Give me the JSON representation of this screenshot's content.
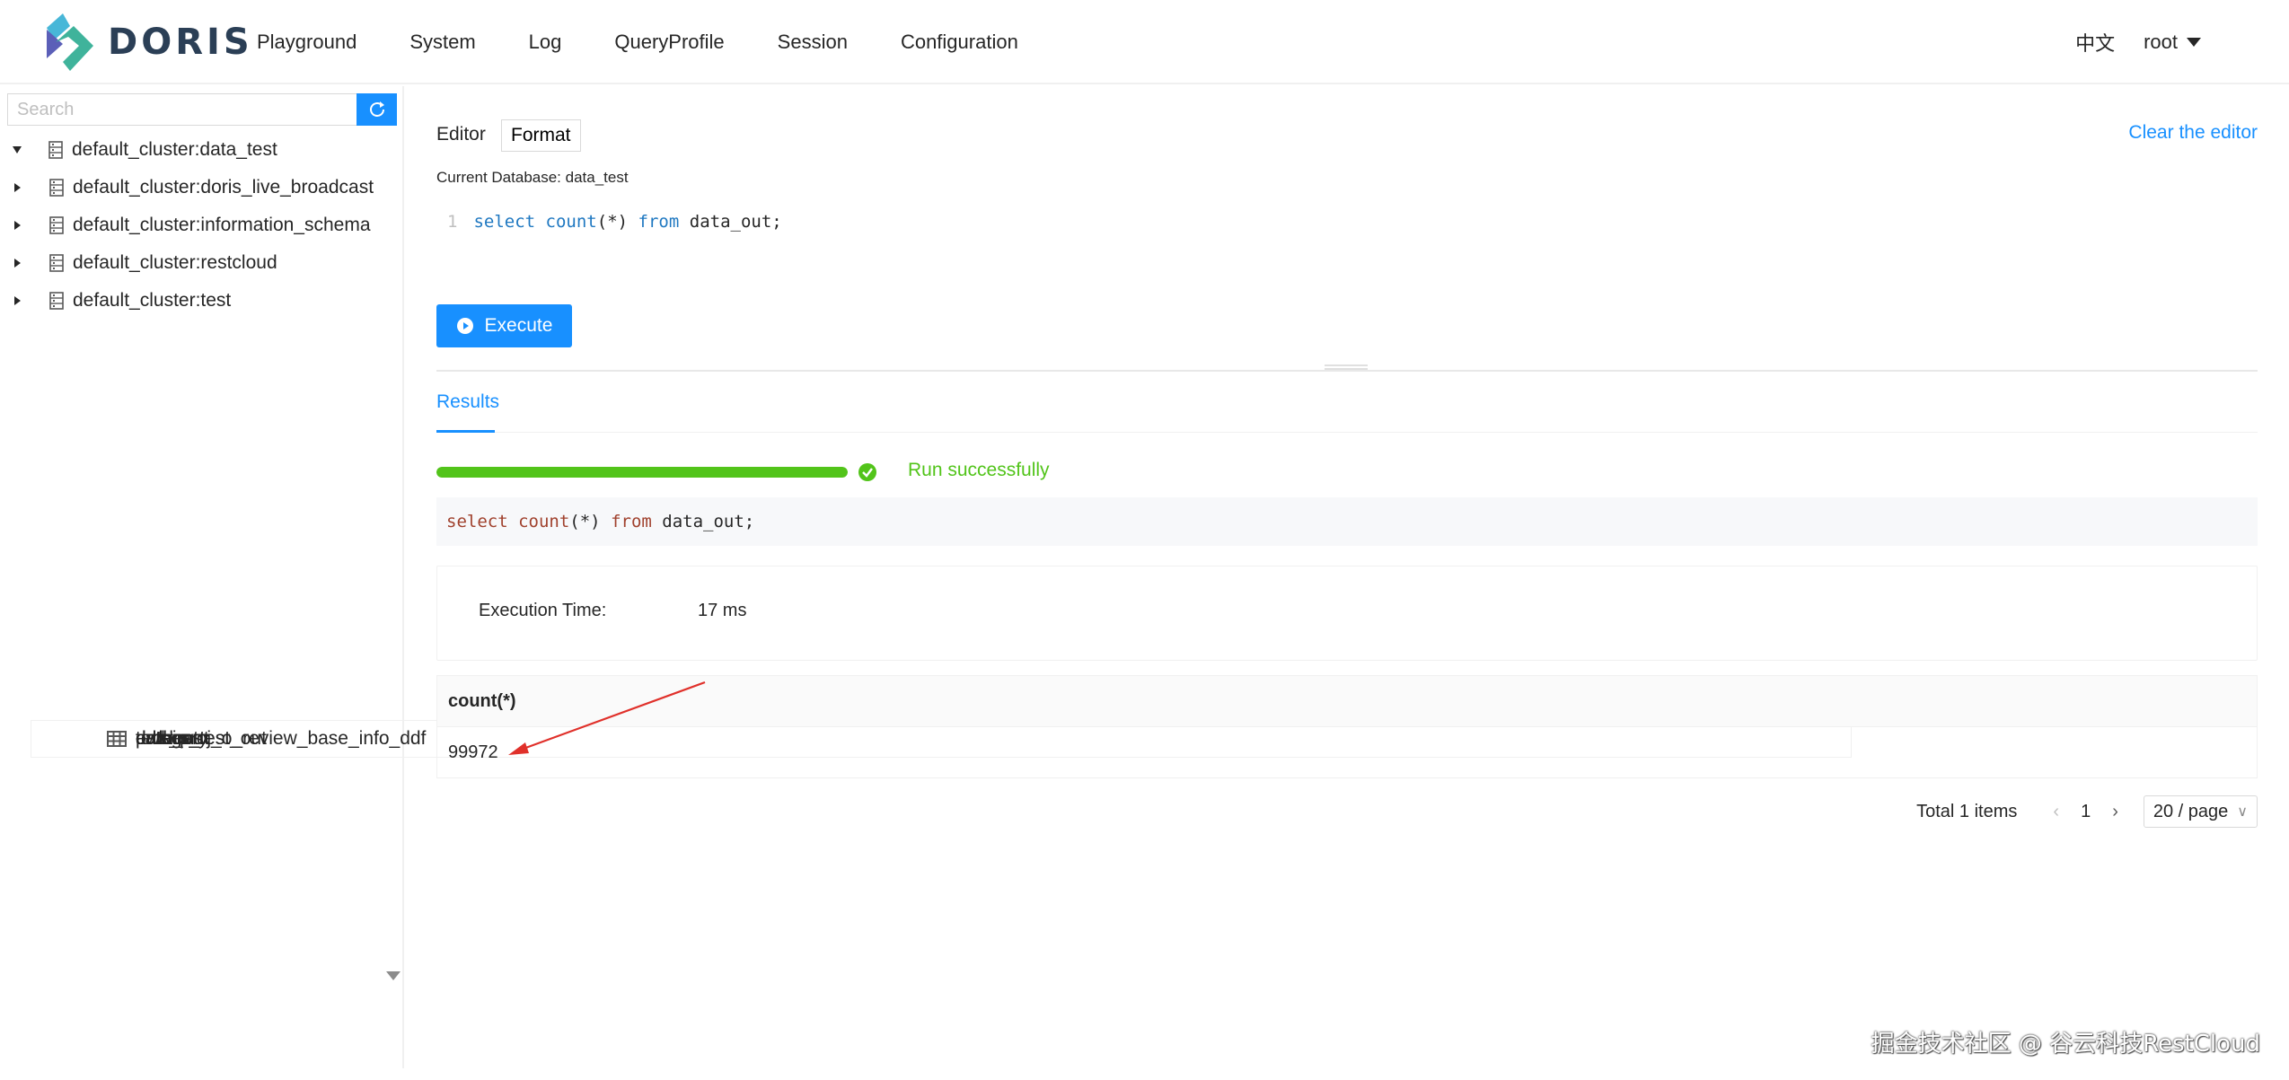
{
  "header": {
    "logo_text": "DORIS",
    "nav": [
      "Playground",
      "System",
      "Log",
      "QueryProfile",
      "Session",
      "Configuration"
    ],
    "language": "中文",
    "user": "root"
  },
  "sidebar": {
    "search_placeholder": "Search",
    "tree": [
      {
        "label": "default_cluster:data_test",
        "expanded": true,
        "tables": [
          "address",
          "admin",
          "category",
          "data_out",
          "dws_proj_o_review_base_info_ddf",
          "orders_test",
          "orders_test_out",
          "product",
          "techer"
        ]
      },
      {
        "label": "default_cluster:doris_live_broadcast",
        "expanded": false
      },
      {
        "label": "default_cluster:information_schema",
        "expanded": false
      },
      {
        "label": "default_cluster:restcloud",
        "expanded": false
      },
      {
        "label": "default_cluster:test",
        "expanded": false
      }
    ]
  },
  "editor": {
    "label": "Editor",
    "format_label": "Format",
    "clear_label": "Clear the editor",
    "current_database": "Current Database: data_test",
    "line_number": "1",
    "code": {
      "select": "select",
      "count": "count",
      "args": "(*)",
      "from": "from",
      "table": "data_out;"
    },
    "execute_label": "Execute"
  },
  "results": {
    "tab_label": "Results",
    "progress": 1.0,
    "status": "Run successfully",
    "sql": {
      "select": "select",
      "count": "count",
      "args": "(*)",
      "from": "from",
      "table": "data_out;"
    },
    "execution_time_label": "Execution Time:",
    "execution_time_value": "17 ms",
    "table": {
      "columns": [
        "count(*)"
      ],
      "rows": [
        [
          "99972"
        ]
      ]
    },
    "pagination": {
      "total": "Total 1 items",
      "page": "1",
      "page_size": "20 / page"
    }
  },
  "watermark": "掘金技术社区 @ 谷云科技RestCloud",
  "colors": {
    "primary": "#1890ff",
    "success": "#52c41a",
    "annotation_arrow": "#e0302a"
  }
}
